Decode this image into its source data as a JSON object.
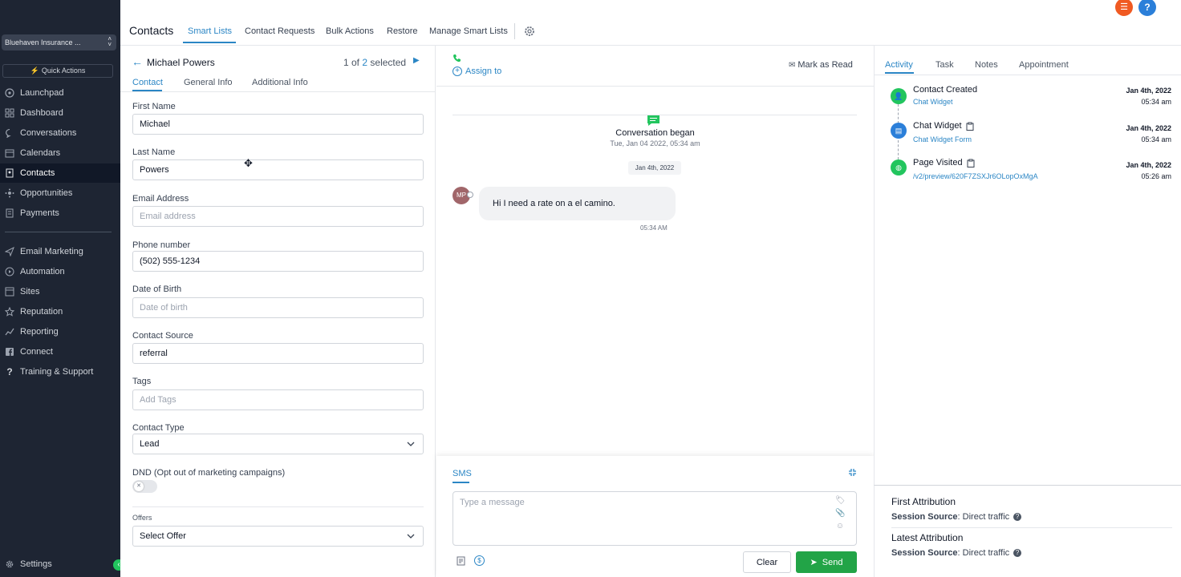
{
  "sidebar": {
    "account_name": "Bluehaven Insurance ...",
    "quick_actions_label": "Quick Actions",
    "items": [
      {
        "label": "Launchpad",
        "icon": "rocket-icon"
      },
      {
        "label": "Dashboard",
        "icon": "dashboard-icon"
      },
      {
        "label": "Conversations",
        "icon": "chat-icon"
      },
      {
        "label": "Calendars",
        "icon": "calendar-icon"
      },
      {
        "label": "Contacts",
        "icon": "contacts-icon"
      },
      {
        "label": "Opportunities",
        "icon": "opportunities-icon"
      },
      {
        "label": "Payments",
        "icon": "payments-icon"
      },
      {
        "label": "Email Marketing",
        "icon": "send-icon"
      },
      {
        "label": "Automation",
        "icon": "automation-icon"
      },
      {
        "label": "Sites",
        "icon": "sites-icon"
      },
      {
        "label": "Reputation",
        "icon": "star-icon"
      },
      {
        "label": "Reporting",
        "icon": "trend-icon"
      },
      {
        "label": "Connect",
        "icon": "facebook-icon"
      },
      {
        "label": "Training & Support",
        "icon": "question-icon"
      }
    ],
    "settings_label": "Settings",
    "active_item": "Contacts"
  },
  "header": {
    "title": "Contacts",
    "tabs": [
      "Smart Lists",
      "Contact Requests",
      "Bulk Actions",
      "Restore",
      "Manage Smart Lists"
    ],
    "active_tab": "Smart Lists"
  },
  "contact": {
    "name": "Michael Powers",
    "pager_prefix": "1 of",
    "pager_count": "2",
    "pager_suffix": "selected",
    "tabs": [
      "Contact",
      "General Info",
      "Additional Info"
    ],
    "active_tab": "Contact",
    "fields": {
      "first_name": {
        "label": "First Name",
        "value": "Michael"
      },
      "last_name": {
        "label": "Last Name",
        "value": "Powers"
      },
      "email": {
        "label": "Email Address",
        "value": "",
        "placeholder": "Email address"
      },
      "phone": {
        "label": "Phone number",
        "value": "(502) 555-1234"
      },
      "dob": {
        "label": "Date of Birth",
        "value": "",
        "placeholder": "Date of birth"
      },
      "source": {
        "label": "Contact Source",
        "value": "referral"
      },
      "tags": {
        "label": "Tags",
        "placeholder": "Add Tags"
      },
      "type": {
        "label": "Contact Type",
        "value": "Lead"
      },
      "dnd": {
        "label": "DND (Opt out of marketing campaigns)"
      },
      "offers": {
        "label": "Offers",
        "value": "Select Offer"
      }
    }
  },
  "conversation": {
    "assign_label": "Assign to",
    "mark_read_label": "Mark as Read",
    "began_title": "Conversation began",
    "began_date": "Tue, Jan 04 2022, 05:34 am",
    "date_chip": "Jan 4th, 2022",
    "avatar_initials": "MP",
    "message": "Hi I need a rate on a el camino.",
    "message_time": "05:34 AM"
  },
  "composer": {
    "tab": "SMS",
    "placeholder": "Type a message",
    "clear_label": "Clear",
    "send_label": "Send"
  },
  "activity": {
    "tabs": [
      "Activity",
      "Task",
      "Notes",
      "Appointment"
    ],
    "active_tab": "Activity",
    "items": [
      {
        "title": "Contact Created",
        "sub": "Chat Widget",
        "date": "Jan 4th, 2022",
        "time": "05:34 am",
        "color": "#22c55e",
        "icon": "contact-created-icon"
      },
      {
        "title": "Chat Widget",
        "sub": "Chat Widget Form",
        "date": "Jan 4th, 2022",
        "time": "05:34 am",
        "color": "#2b7fd9",
        "icon": "form-icon"
      },
      {
        "title": "Page Visited",
        "sub": "/v2/preview/620F7ZSXJr6OLopOxMgA",
        "date": "Jan 4th, 2022",
        "time": "05:26 am",
        "color": "#22c55e",
        "icon": "globe-icon"
      }
    ]
  },
  "attribution": {
    "first_title": "First Attribution",
    "latest_title": "Latest Attribution",
    "session_label": "Session Source",
    "first_source": "Direct traffic",
    "latest_source": "Direct traffic"
  },
  "colors": {
    "accent": "#2b86c5",
    "sidebar_bg": "#1e2533",
    "success": "#22a447",
    "notification": "#f05a22"
  }
}
